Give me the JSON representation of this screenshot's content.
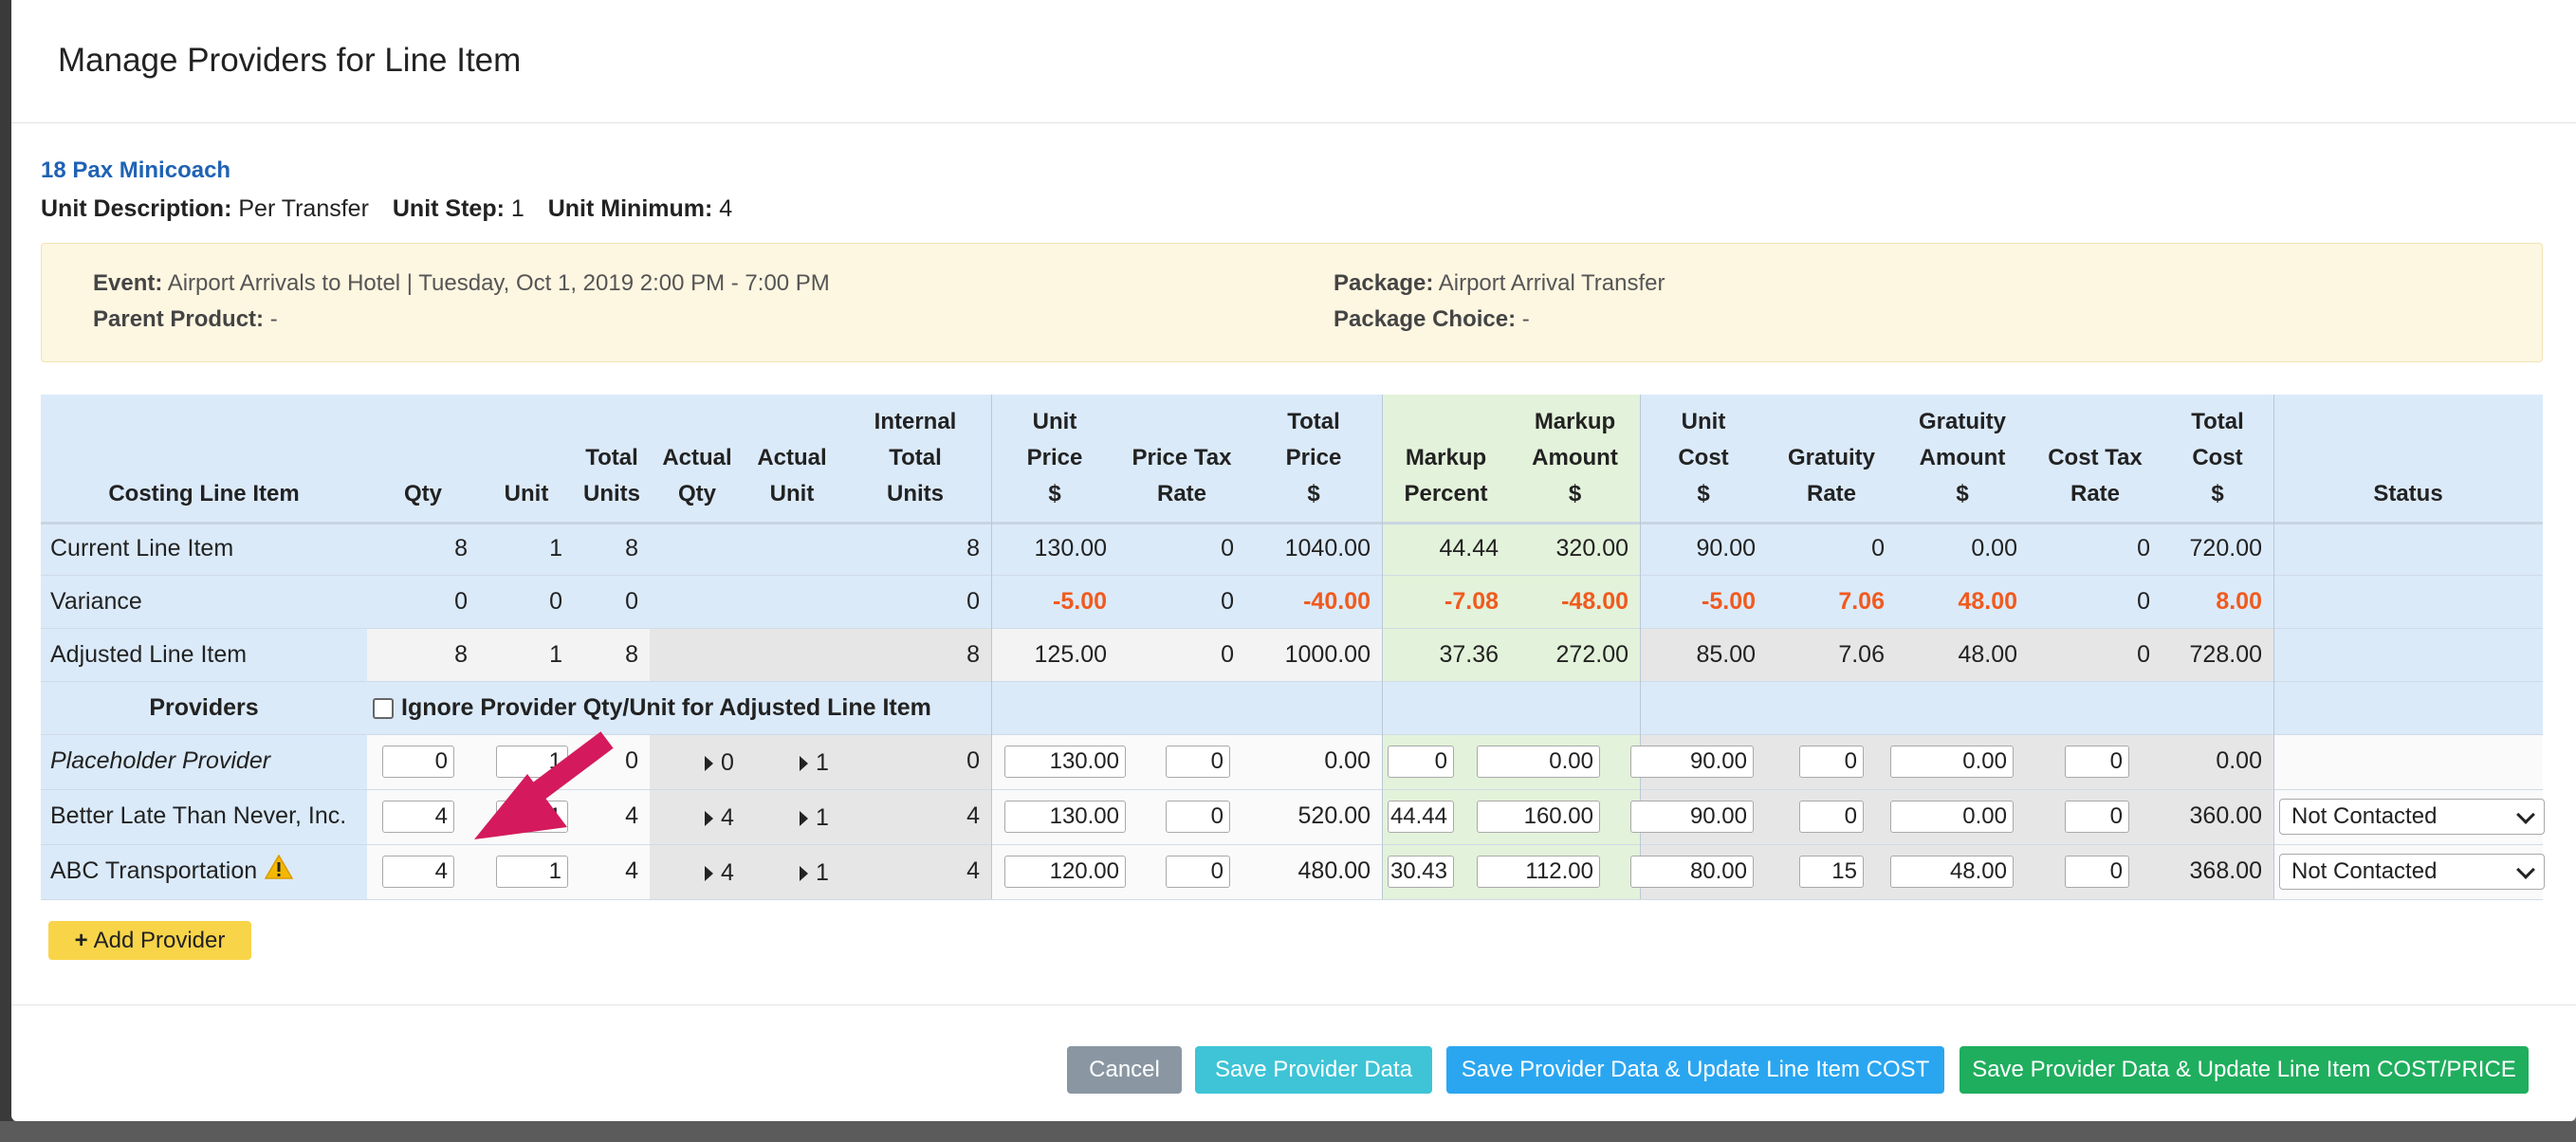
{
  "modal": {
    "title": "Manage Providers for Line Item"
  },
  "product": {
    "name": "18 Pax Minicoach",
    "unit_description_label": "Unit Description:",
    "unit_description": "Per Transfer",
    "unit_step_label": "Unit Step:",
    "unit_step": "1",
    "unit_minimum_label": "Unit Minimum:",
    "unit_minimum": "4"
  },
  "event_info": {
    "event_label": "Event:",
    "event": "Airport Arrivals to Hotel | Tuesday, Oct 1, 2019 2:00 PM - 7:00 PM",
    "parent_product_label": "Parent Product:",
    "parent_product": "-",
    "package_label": "Package:",
    "package": "Airport Arrival Transfer",
    "package_choice_label": "Package Choice:",
    "package_choice": "-"
  },
  "table": {
    "headers": {
      "costing_line_item": "Costing Line Item",
      "qty": "Qty",
      "unit": "Unit",
      "total_units": [
        "Total",
        "Units"
      ],
      "actual_qty": [
        "Actual",
        "Qty"
      ],
      "actual_unit": [
        "Actual",
        "Unit"
      ],
      "internal_total_units": [
        "Internal",
        "Total",
        "Units"
      ],
      "unit_price": [
        "Unit",
        "Price",
        "$"
      ],
      "price_tax_rate": [
        "Price Tax",
        "Rate"
      ],
      "total_price": [
        "Total",
        "Price",
        "$"
      ],
      "markup_percent": [
        "Markup",
        "Percent"
      ],
      "markup_amount": [
        "Markup",
        "Amount",
        "$"
      ],
      "unit_cost": [
        "Unit",
        "Cost",
        "$"
      ],
      "gratuity_rate": [
        "Gratuity",
        "Rate"
      ],
      "gratuity_amount": [
        "Gratuity",
        "Amount",
        "$"
      ],
      "cost_tax_rate": [
        "Cost Tax",
        "Rate"
      ],
      "total_cost": [
        "Total",
        "Cost",
        "$"
      ],
      "status": "Status"
    },
    "summary_rows": [
      {
        "label": "Current Line Item",
        "qty": "8",
        "unit": "1",
        "total_units": "8",
        "internal_total_units": "8",
        "unit_price": "130.00",
        "price_tax_rate": "0",
        "total_price": "1040.00",
        "markup_percent": "44.44",
        "markup_amount": "320.00",
        "unit_cost": "90.00",
        "gratuity_rate": "0",
        "gratuity_amount": "0.00",
        "cost_tax_rate": "0",
        "total_cost": "720.00"
      },
      {
        "label": "Variance",
        "qty": "0",
        "unit": "0",
        "total_units": "0",
        "internal_total_units": "0",
        "unit_price": "-5.00",
        "price_tax_rate": "0",
        "total_price": "-40.00",
        "markup_percent": "-7.08",
        "markup_amount": "-48.00",
        "unit_cost": "-5.00",
        "gratuity_rate": "7.06",
        "gratuity_amount": "48.00",
        "cost_tax_rate": "0",
        "total_cost": "8.00"
      },
      {
        "label": "Adjusted Line Item",
        "qty": "8",
        "unit": "1",
        "total_units": "8",
        "internal_total_units": "8",
        "unit_price": "125.00",
        "price_tax_rate": "0",
        "total_price": "1000.00",
        "markup_percent": "37.36",
        "markup_amount": "272.00",
        "unit_cost": "85.00",
        "gratuity_rate": "7.06",
        "gratuity_amount": "48.00",
        "cost_tax_rate": "0",
        "total_cost": "728.00"
      }
    ],
    "providers_label": "Providers",
    "ignore_label": "Ignore Provider Qty/Unit for Adjusted Line Item",
    "provider_rows": [
      {
        "name": "Placeholder Provider",
        "qty": "0",
        "unit": "1",
        "total_units": "0",
        "actual_qty": "0",
        "actual_unit": "1",
        "internal_total_units": "0",
        "unit_price": "130.00",
        "price_tax_rate": "0",
        "total_price": "0.00",
        "markup_percent": "0",
        "markup_amount": "0.00",
        "unit_cost": "90.00",
        "gratuity_rate": "0",
        "gratuity_amount": "0.00",
        "cost_tax_rate": "0",
        "total_cost": "0.00",
        "status": ""
      },
      {
        "name": "Better Late Than Never, Inc.",
        "qty": "4",
        "unit": "1",
        "total_units": "4",
        "actual_qty": "4",
        "actual_unit": "1",
        "internal_total_units": "4",
        "unit_price": "130.00",
        "price_tax_rate": "0",
        "total_price": "520.00",
        "markup_percent": "44.44",
        "markup_amount": "160.00",
        "unit_cost": "90.00",
        "gratuity_rate": "0",
        "gratuity_amount": "0.00",
        "cost_tax_rate": "0",
        "total_cost": "360.00",
        "status": "Not Contacted"
      },
      {
        "name": "ABC Transportation",
        "qty": "4",
        "unit": "1",
        "total_units": "4",
        "actual_qty": "4",
        "actual_unit": "1",
        "internal_total_units": "4",
        "unit_price": "120.00",
        "price_tax_rate": "0",
        "total_price": "480.00",
        "markup_percent": "30.43",
        "markup_amount": "112.00",
        "unit_cost": "80.00",
        "gratuity_rate": "15",
        "gratuity_amount": "48.00",
        "cost_tax_rate": "0",
        "total_cost": "368.00",
        "status": "Not Contacted"
      }
    ]
  },
  "buttons": {
    "add_provider": "Add Provider",
    "cancel": "Cancel",
    "save_provider_data": "Save Provider Data",
    "save_update_cost": "Save Provider Data & Update Line Item COST",
    "save_update_cost_price": "Save Provider Data & Update Line Item COST/PRICE"
  },
  "colors": {
    "header_blue": "#dbeaf9",
    "markup_green": "#e3f2da",
    "variance_red": "#f05a1e",
    "add_yellow": "#f8d449",
    "cancel_gray": "#8a97a3",
    "save_cyan": "#3ec4d6",
    "save_blue": "#2aa6f0",
    "save_green": "#1fae5e",
    "annotation_arrow": "#d41a5c"
  },
  "icons": {
    "warning": "warning-icon",
    "plus": "plus-icon",
    "caret": "caret-right-icon",
    "annotation": "annotation-arrow"
  }
}
